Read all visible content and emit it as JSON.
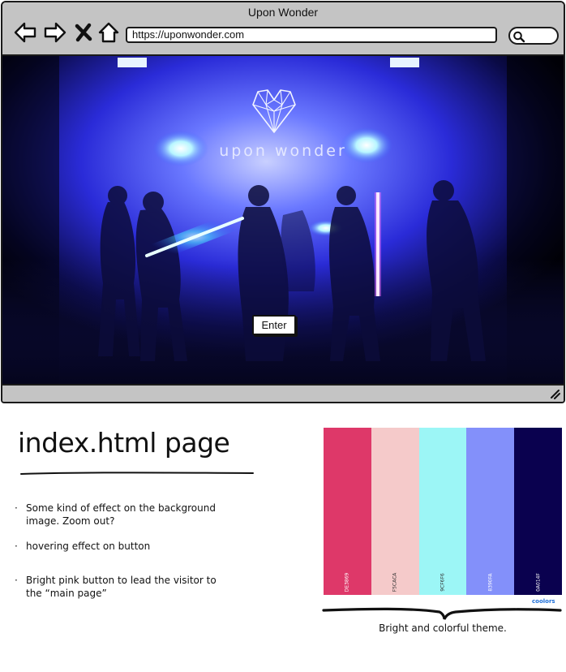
{
  "window": {
    "title": "Upon Wonder",
    "url": "https://uponwonder.com"
  },
  "hero": {
    "brand_text": "upon wonder",
    "enter_label": "Enter"
  },
  "annotations": {
    "page_title": "index.html page",
    "notes": [
      "Some kind of effect on the background image. Zoom out?",
      "hovering effect on button",
      "Bright pink button to lead the visitor to the “main page”"
    ],
    "palette_caption": "Bright and colorful theme."
  },
  "palette": {
    "swatches": [
      {
        "hex": "DE3869",
        "color": "#DE3869",
        "text_color": "#ffffff"
      },
      {
        "hex": "F5CACA",
        "color": "#F5CACA",
        "text_color": "#333333"
      },
      {
        "hex": "9CF6F6",
        "color": "#9CF6F6",
        "text_color": "#333333"
      },
      {
        "hex": "8390FA",
        "color": "#8390FA",
        "text_color": "#ffffff"
      },
      {
        "hex": "0A014F",
        "color": "#0A014F",
        "text_color": "#ffffff"
      }
    ],
    "brand": "coolors"
  },
  "icons": {
    "back": "arrow-left-icon",
    "forward": "arrow-right-icon",
    "stop": "close-icon",
    "home": "home-icon",
    "search": "search-icon",
    "resize": "resize-grip-icon",
    "logo": "heart-crystal-logo"
  }
}
